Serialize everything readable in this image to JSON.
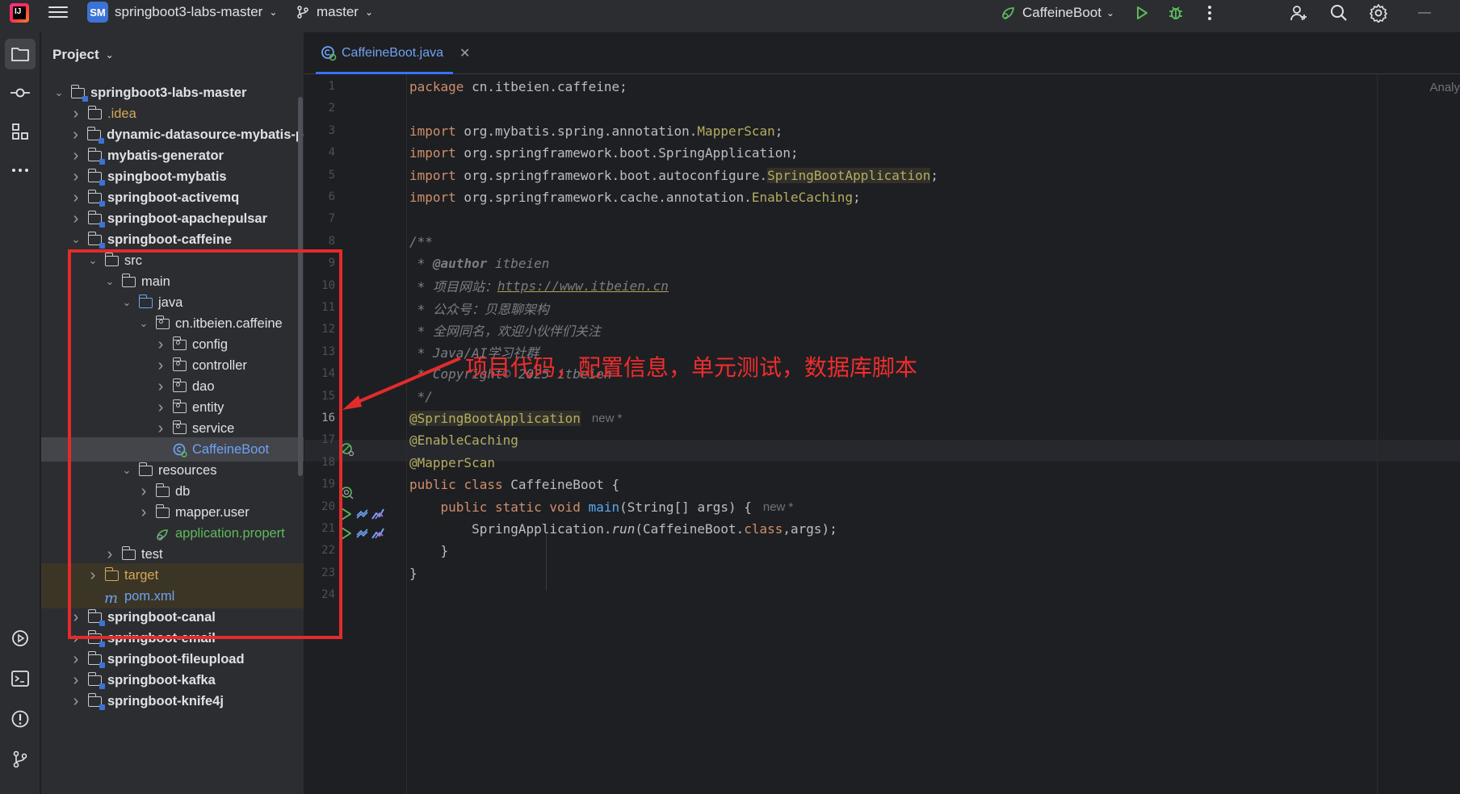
{
  "titlebar": {
    "project_badge": "SM",
    "project_name": "springboot3-labs-master",
    "branch": "master",
    "run_config": "CaffeineBoot"
  },
  "project_panel": {
    "title": "Project",
    "tree": [
      {
        "label": "springboot3-labs-master",
        "depth": 0,
        "expanded": true,
        "kind": "module",
        "bold": true
      },
      {
        "label": ".idea",
        "depth": 1,
        "expanded": false,
        "kind": "folder",
        "color": "orange"
      },
      {
        "label": "dynamic-datasource-mybatis-p",
        "depth": 1,
        "expanded": false,
        "kind": "module",
        "bold": true
      },
      {
        "label": "mybatis-generator",
        "depth": 1,
        "expanded": false,
        "kind": "module",
        "bold": true
      },
      {
        "label": "spingboot-mybatis",
        "depth": 1,
        "expanded": false,
        "kind": "module",
        "bold": true
      },
      {
        "label": "springboot-activemq",
        "depth": 1,
        "expanded": false,
        "kind": "module",
        "bold": true
      },
      {
        "label": "springboot-apachepulsar",
        "depth": 1,
        "expanded": false,
        "kind": "module",
        "bold": true
      },
      {
        "label": "springboot-caffeine",
        "depth": 1,
        "expanded": true,
        "kind": "module",
        "bold": true
      },
      {
        "label": "src",
        "depth": 2,
        "expanded": true,
        "kind": "folder"
      },
      {
        "label": "main",
        "depth": 3,
        "expanded": true,
        "kind": "folder"
      },
      {
        "label": "java",
        "depth": 4,
        "expanded": true,
        "kind": "folder",
        "folder_color": "blue"
      },
      {
        "label": "cn.itbeien.caffeine",
        "depth": 5,
        "expanded": true,
        "kind": "package"
      },
      {
        "label": "config",
        "depth": 6,
        "expanded": false,
        "kind": "package"
      },
      {
        "label": "controller",
        "depth": 6,
        "expanded": false,
        "kind": "package"
      },
      {
        "label": "dao",
        "depth": 6,
        "expanded": false,
        "kind": "package"
      },
      {
        "label": "entity",
        "depth": 6,
        "expanded": false,
        "kind": "package"
      },
      {
        "label": "service",
        "depth": 6,
        "expanded": false,
        "kind": "package"
      },
      {
        "label": "CaffeineBoot",
        "depth": 6,
        "kind": "class",
        "color": "blue",
        "selected": true
      },
      {
        "label": "resources",
        "depth": 4,
        "expanded": true,
        "kind": "folder"
      },
      {
        "label": "db",
        "depth": 5,
        "expanded": false,
        "kind": "folder"
      },
      {
        "label": "mapper.user",
        "depth": 5,
        "expanded": false,
        "kind": "folder"
      },
      {
        "label": "application.propert",
        "depth": 5,
        "kind": "properties",
        "color": "green"
      },
      {
        "label": "test",
        "depth": 3,
        "expanded": false,
        "kind": "folder"
      },
      {
        "label": "target",
        "depth": 2,
        "expanded": false,
        "kind": "folder",
        "color": "orange",
        "folder_color": "orange",
        "excluded": true
      },
      {
        "label": "pom.xml",
        "depth": 2,
        "kind": "maven",
        "color": "blue",
        "excluded": true
      },
      {
        "label": "springboot-canal",
        "depth": 1,
        "expanded": false,
        "kind": "module",
        "bold": true
      },
      {
        "label": "springboot-email",
        "depth": 1,
        "expanded": false,
        "kind": "module",
        "bold": true
      },
      {
        "label": "springboot-fileupload",
        "depth": 1,
        "expanded": false,
        "kind": "module",
        "bold": true
      },
      {
        "label": "springboot-kafka",
        "depth": 1,
        "expanded": false,
        "kind": "module",
        "bold": true
      },
      {
        "label": "springboot-knife4j",
        "depth": 1,
        "expanded": false,
        "kind": "module",
        "bold": true
      }
    ]
  },
  "editor": {
    "tab_label": "CaffeineBoot.java",
    "right_label": "Analy",
    "current_line": 16,
    "lines": [
      [
        {
          "t": "package",
          "c": "kw"
        },
        {
          "t": " cn.itbeien.caffeine;"
        }
      ],
      [],
      [
        {
          "t": "import",
          "c": "kw"
        },
        {
          "t": " org.mybatis.spring.annotation."
        },
        {
          "t": "MapperScan",
          "c": "ann"
        },
        {
          "t": ";"
        }
      ],
      [
        {
          "t": "import",
          "c": "kw"
        },
        {
          "t": " org.springframework.boot.SpringApplication;"
        }
      ],
      [
        {
          "t": "import",
          "c": "kw"
        },
        {
          "t": " org.springframework.boot.autoconfigure."
        },
        {
          "t": "SpringBootApplication",
          "c": "ann-hl"
        },
        {
          "t": ";"
        }
      ],
      [
        {
          "t": "import",
          "c": "kw"
        },
        {
          "t": " org.springframework.cache.annotation."
        },
        {
          "t": "EnableCaching",
          "c": "ann"
        },
        {
          "t": ";"
        }
      ],
      [],
      [
        {
          "t": "/**",
          "c": "cmt"
        }
      ],
      [
        {
          "t": " * ",
          "c": "cmt"
        },
        {
          "t": "@author",
          "c": "cmt-tag"
        },
        {
          "t": " itbeien",
          "c": "cmt"
        }
      ],
      [
        {
          "t": " * 项目网站：",
          "c": "cmt"
        },
        {
          "t": "https://www.itbeien.cn",
          "c": "link"
        }
      ],
      [
        {
          "t": " * 公众号：贝恩聊架构",
          "c": "cmt"
        }
      ],
      [
        {
          "t": " * 全网同名，欢迎小伙伴们关注",
          "c": "cmt"
        }
      ],
      [
        {
          "t": " * Java/AI学习社群",
          "c": "cmt"
        }
      ],
      [
        {
          "t": " * Copyright© 2025 itbeien",
          "c": "cmt"
        }
      ],
      [
        {
          "t": " */",
          "c": "cmt"
        }
      ],
      [
        {
          "t": "@SpringBootApplication",
          "c": "ann-hl"
        },
        {
          "t": "new *",
          "c": "hint"
        }
      ],
      [
        {
          "t": "@EnableCaching",
          "c": "ann"
        }
      ],
      [
        {
          "t": "@MapperScan",
          "c": "ann"
        }
      ],
      [
        {
          "t": "public",
          "c": "kw"
        },
        {
          "t": " "
        },
        {
          "t": "class",
          "c": "kw"
        },
        {
          "t": " CaffeineBoot {"
        }
      ],
      [
        {
          "t": "    "
        },
        {
          "t": "public",
          "c": "kw"
        },
        {
          "t": " "
        },
        {
          "t": "static",
          "c": "kw"
        },
        {
          "t": " "
        },
        {
          "t": "void",
          "c": "kw"
        },
        {
          "t": " "
        },
        {
          "t": "main",
          "c": "fn"
        },
        {
          "t": "(String[] args) {"
        },
        {
          "t": "new *",
          "c": "hint"
        }
      ],
      [
        {
          "t": "        SpringApplication."
        },
        {
          "t": "run",
          "c": "ital"
        },
        {
          "t": "(CaffeineBoot."
        },
        {
          "t": "class",
          "c": "kw"
        },
        {
          "t": ",args);"
        }
      ],
      [
        {
          "t": "    }"
        }
      ],
      [
        {
          "t": "}"
        }
      ],
      []
    ]
  },
  "annotation": {
    "text": "项目代码，配置信息，单元测试，数据库脚本",
    "color": "#e32b2b"
  }
}
